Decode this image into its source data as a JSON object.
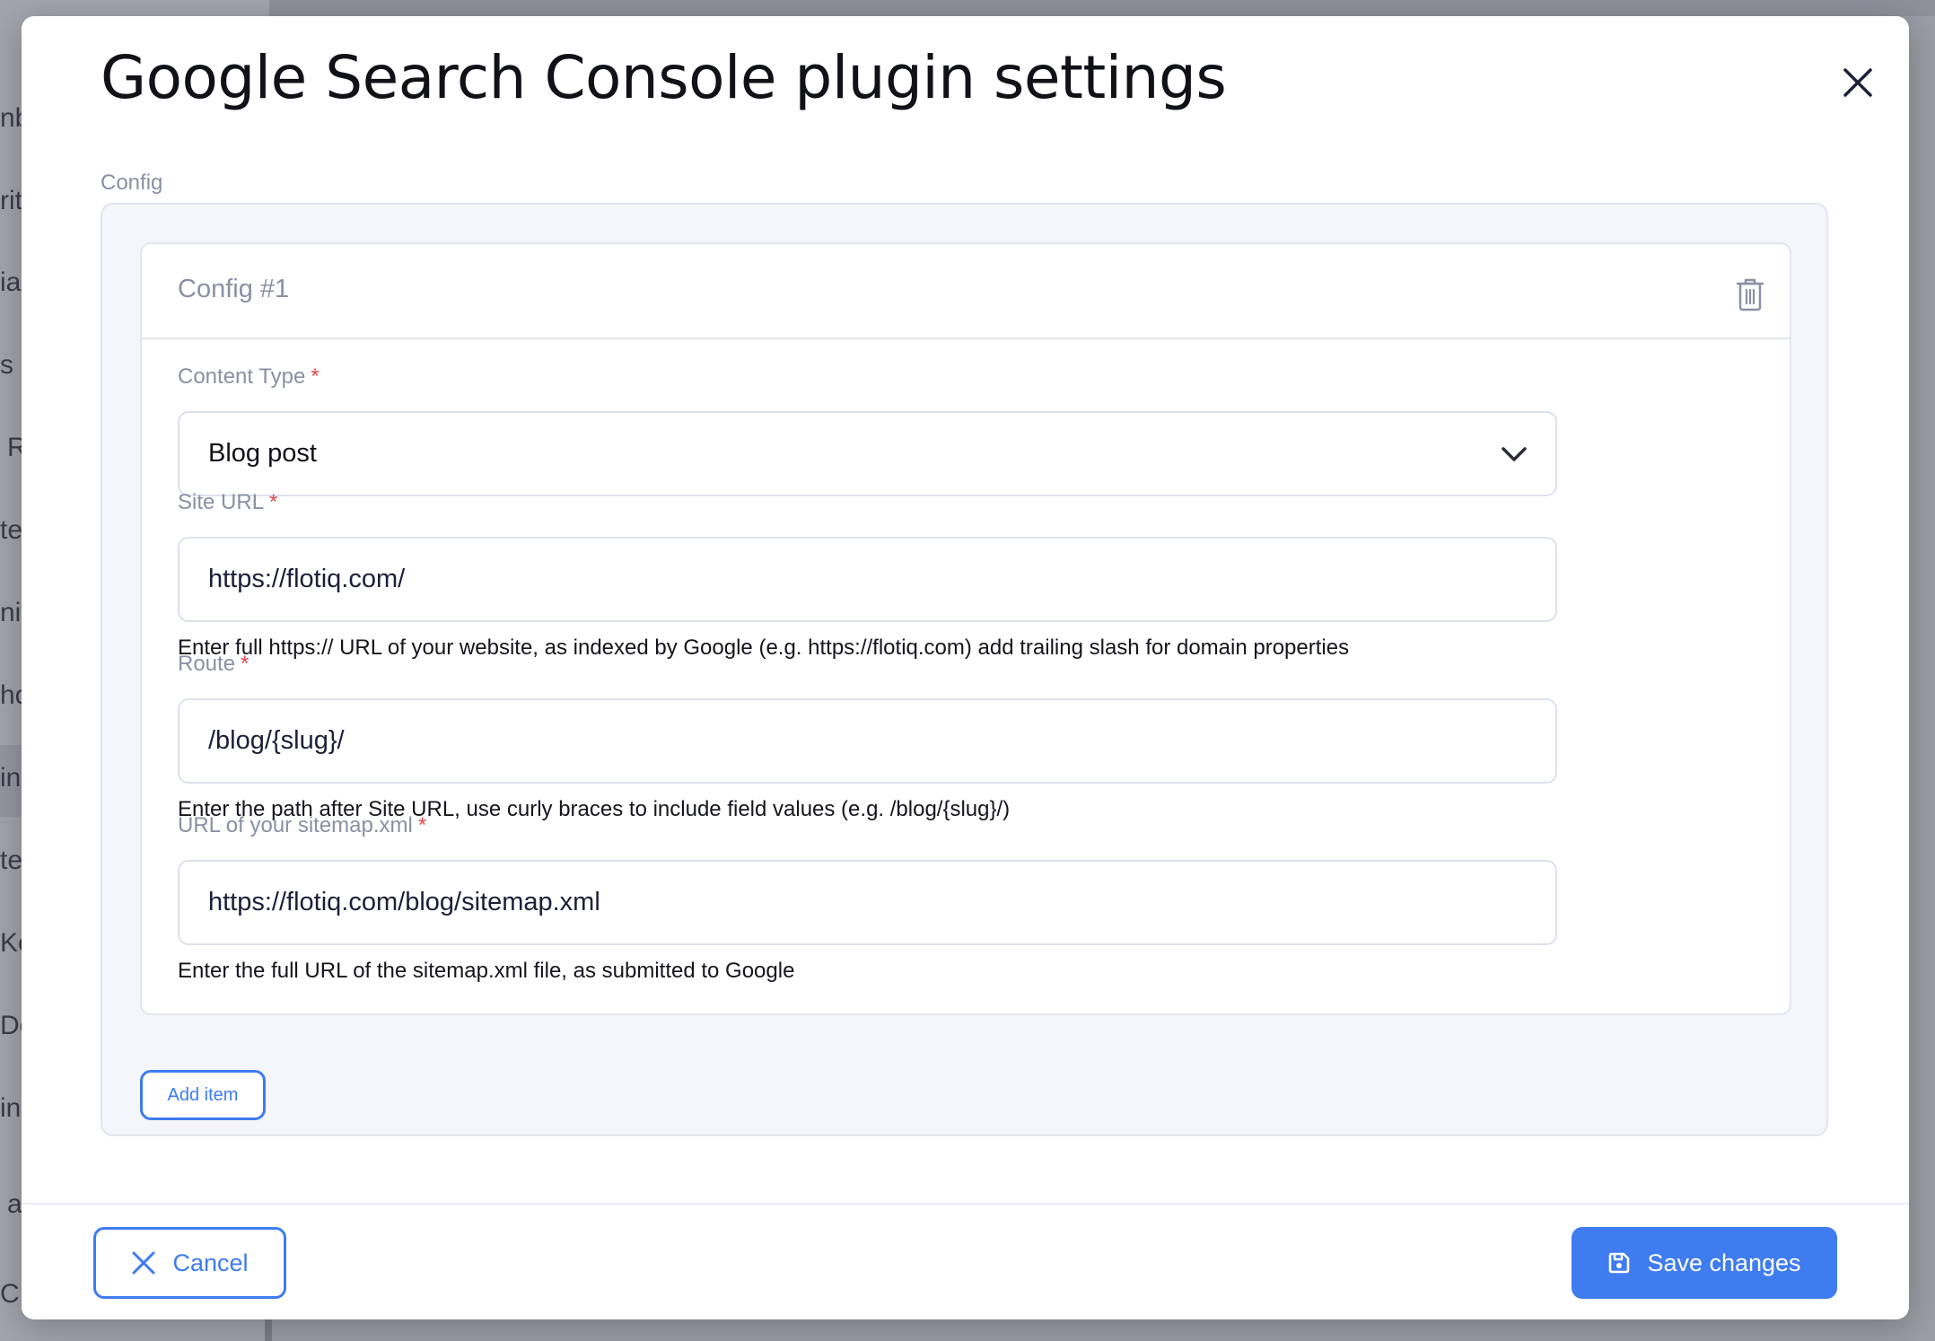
{
  "background": {
    "sidebar_fragments": [
      "nb",
      "rit",
      "ia",
      "s",
      "R",
      "te",
      "nit",
      "ho",
      "ins",
      "te",
      "Ke",
      "Do",
      "in",
      "a",
      "C"
    ]
  },
  "modal": {
    "title": "Google Search Console plugin settings",
    "section_label": "Config",
    "config_item": {
      "title": "Config #1",
      "fields": {
        "content_type": {
          "label": "Content Type",
          "required_mark": "*",
          "value": "Blog post"
        },
        "site_url": {
          "label": "Site URL",
          "required_mark": "*",
          "value": "https://flotiq.com/",
          "help": "Enter full https:// URL of your website, as indexed by Google (e.g. https://flotiq.com) add trailing slash for domain properties"
        },
        "route": {
          "label": "Route",
          "required_mark": "*",
          "value": "/blog/{slug}/",
          "help": "Enter the path after Site URL, use curly braces to include field values (e.g. /blog/{slug}/)"
        },
        "sitemap_url": {
          "label": "URL of your sitemap.xml",
          "required_mark": "*",
          "value": "https://flotiq.com/blog/sitemap.xml",
          "help": "Enter the full URL of the sitemap.xml file, as submitted to Google"
        }
      }
    },
    "add_item_label": "Add item",
    "footer": {
      "cancel_label": "Cancel",
      "save_label": "Save changes"
    }
  },
  "colors": {
    "accent": "#3e7cf0",
    "required": "#e5484d",
    "label": "#8a90a4"
  },
  "icons": {
    "close": "close-icon",
    "trash": "trash-icon",
    "chevron": "chevron-down-icon",
    "cancel": "x-icon",
    "save": "floppy-disk-icon"
  }
}
